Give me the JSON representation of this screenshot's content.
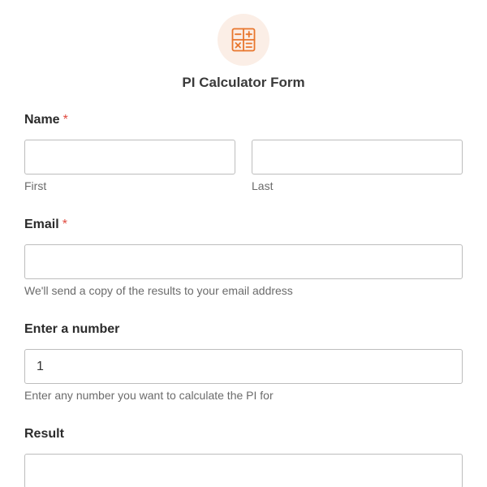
{
  "form": {
    "title": "PI Calculator Form",
    "icon": "calculator-icon",
    "accent_color": "#e8762d",
    "required_mark": "*"
  },
  "fields": {
    "name": {
      "label": "Name",
      "required": true,
      "first": {
        "value": "",
        "sublabel": "First"
      },
      "last": {
        "value": "",
        "sublabel": "Last"
      }
    },
    "email": {
      "label": "Email",
      "required": true,
      "value": "",
      "description": "We'll send a copy of the results to your email address"
    },
    "number": {
      "label": "Enter a number",
      "value": "1",
      "description": "Enter any number you want to calculate the PI for"
    },
    "result": {
      "label": "Result",
      "value": ""
    }
  }
}
